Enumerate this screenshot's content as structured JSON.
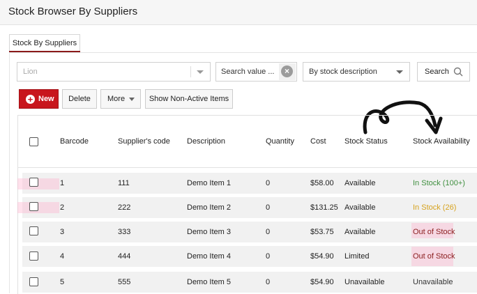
{
  "window": {
    "title": "Stock Browser By Suppliers"
  },
  "tabs": [
    {
      "label": "Stock By Suppliers",
      "active": true
    }
  ],
  "filters": {
    "supplier_combo_placeholder": "Lion",
    "search_value": "Search value ...",
    "field_select": "By stock description",
    "search_button": "Search"
  },
  "toolbar": {
    "new_label": "New",
    "delete_label": "Delete",
    "more_label": "More",
    "non_active_label": "Show Non-Active Items"
  },
  "table": {
    "columns": [
      "Barcode",
      "Supplier's code",
      "Description",
      "Quantity",
      "Cost",
      "Stock Status",
      "Stock Availability"
    ],
    "rows": [
      {
        "barcode": "1",
        "code": "111",
        "description": "Demo Item 1",
        "quantity": "0",
        "cost": "$58.00",
        "status": "Available",
        "availability": "In Stock (100+)",
        "avail_color": "#3f8f3f"
      },
      {
        "barcode": "2",
        "code": "222",
        "description": "Demo Item 2",
        "quantity": "0",
        "cost": "$131.25",
        "status": "Available",
        "availability": "In Stock (26)",
        "avail_color": "#d6a21d"
      },
      {
        "barcode": "3",
        "code": "333",
        "description": "Demo Item 3",
        "quantity": "0",
        "cost": "$53.75",
        "status": "Available",
        "availability": "Out of Stock",
        "avail_color": "#8a1d1d"
      },
      {
        "barcode": "4",
        "code": "444",
        "description": "Demo Item 4",
        "quantity": "0",
        "cost": "$54.90",
        "status": "Limited",
        "availability": "Out of Stock",
        "avail_color": "#8a1d1d"
      },
      {
        "barcode": "5",
        "code": "555",
        "description": "Demo Item 5",
        "quantity": "0",
        "cost": "$54.90",
        "status": "Unavailable",
        "availability": "Unavailable",
        "avail_color": "#333333"
      }
    ]
  },
  "colors": {
    "accent": "#8b1a1a",
    "new_button": "#c8161d"
  },
  "icons": [
    "clear-icon",
    "search-icon",
    "plus-icon",
    "chevron-down-icon",
    "curved-arrow-annotation"
  ]
}
